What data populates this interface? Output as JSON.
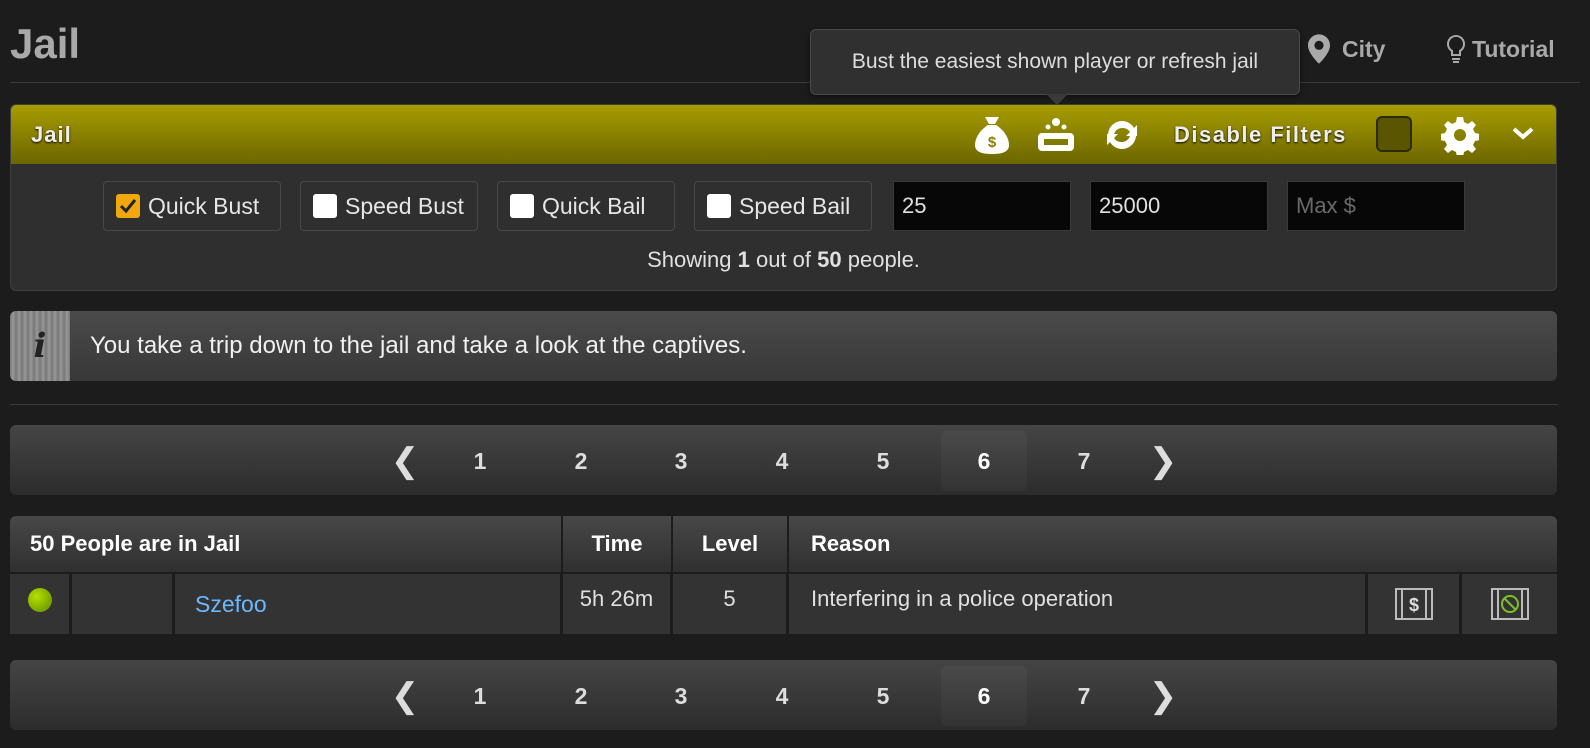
{
  "page": {
    "title": "Jail"
  },
  "top_links": {
    "city": "City",
    "tutorial": "Tutorial"
  },
  "tooltip": {
    "text": "Bust the easiest shown player or refresh jail"
  },
  "panel": {
    "title": "Jail",
    "disable_filters_label": "Disable Filters",
    "icons": [
      "money-bag-icon",
      "bust-icon",
      "refresh-icon",
      "gear-icon",
      "chevron-down-icon"
    ]
  },
  "filters": {
    "checkboxes": [
      {
        "label": "Quick Bust",
        "checked": true
      },
      {
        "label": "Speed Bust",
        "checked": false
      },
      {
        "label": "Quick Bail",
        "checked": false
      },
      {
        "label": "Speed Bail",
        "checked": false
      }
    ],
    "inputs": [
      {
        "value": "25",
        "placeholder": ""
      },
      {
        "value": "25000",
        "placeholder": ""
      },
      {
        "value": "",
        "placeholder": "Max $"
      }
    ],
    "showing": {
      "prefix": "Showing",
      "shown": "1",
      "middle": "out of",
      "total": "50",
      "suffix": "people."
    }
  },
  "info": {
    "text": "You take a trip down to the jail and take a look at the captives."
  },
  "pagination": {
    "prev": "❮",
    "next": "❯",
    "pages": [
      "1",
      "2",
      "3",
      "4",
      "5",
      "6",
      "7"
    ],
    "active": "6"
  },
  "table": {
    "headers": {
      "people": "50 People are in Jail",
      "time": "Time",
      "level": "Level",
      "reason": "Reason"
    },
    "rows": [
      {
        "name": "Szefoo",
        "time": "5h 26m",
        "level": "5",
        "reason": "Interfering in a police operation",
        "status": "online"
      }
    ]
  },
  "colors": {
    "panel_header": "#a89c00",
    "accent_check": "#f1a80f",
    "link": "#6bb8ff",
    "online": "#9ccf00"
  }
}
